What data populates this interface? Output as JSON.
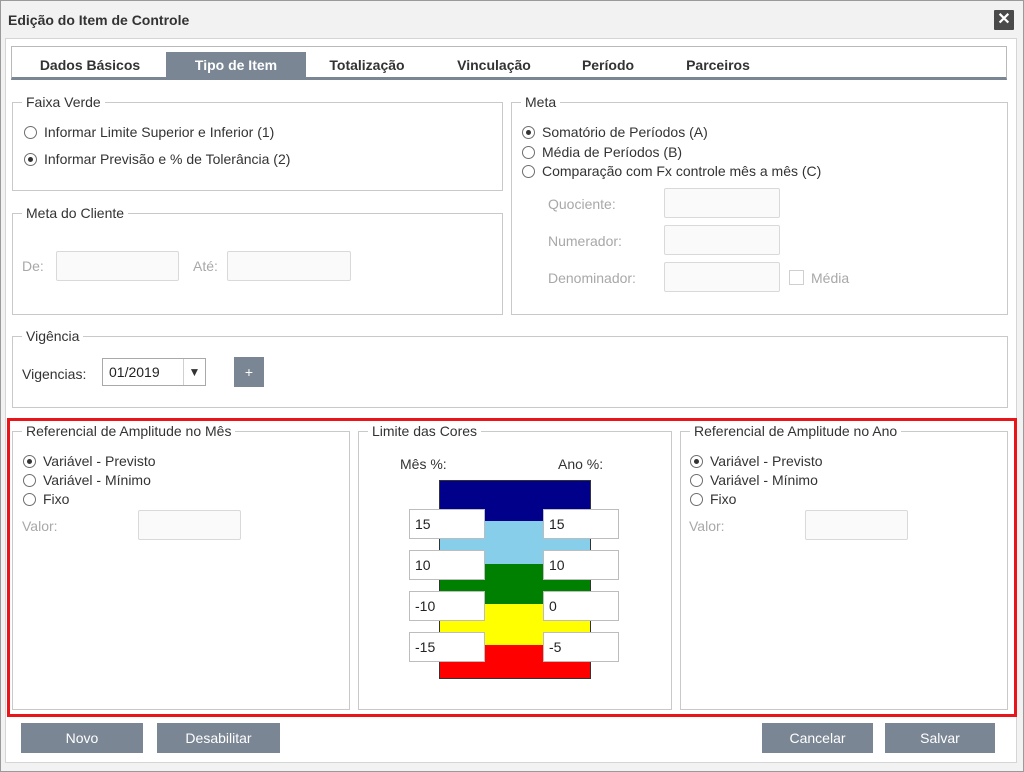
{
  "window": {
    "title": "Edição do Item de Controle",
    "close_glyph": "✕"
  },
  "tabs": [
    {
      "label": "Dados Básicos",
      "active": false
    },
    {
      "label": "Tipo de Item",
      "active": true
    },
    {
      "label": "Totalização",
      "active": false
    },
    {
      "label": "Vinculação",
      "active": false
    },
    {
      "label": "Período",
      "active": false
    },
    {
      "label": "Parceiros",
      "active": false
    }
  ],
  "faixa_verde": {
    "legend": "Faixa Verde",
    "options": [
      {
        "label": "Informar Limite Superior e Inferior (1)",
        "selected": false
      },
      {
        "label": "Informar Previsão e % de Tolerância (2)",
        "selected": true
      }
    ]
  },
  "meta_cliente": {
    "legend": "Meta do Cliente",
    "de_label": "De:",
    "de_value": "",
    "ate_label": "Até:",
    "ate_value": ""
  },
  "meta": {
    "legend": "Meta",
    "options": [
      {
        "label": "Somatório de Períodos (A)",
        "selected": true
      },
      {
        "label": "Média de Períodos (B)",
        "selected": false
      },
      {
        "label": "Comparação com Fx controle mês a mês (C)",
        "selected": false
      }
    ],
    "quociente_label": "Quociente:",
    "numerador_label": "Numerador:",
    "denominador_label": "Denominador:",
    "media_label": "Média",
    "media_checked": false
  },
  "vigencia": {
    "legend": "Vigência",
    "label": "Vigencias:",
    "selected": "01/2019",
    "add_label": "+"
  },
  "amplitude_mes": {
    "legend": "Referencial de Amplitude no Mês",
    "options": [
      {
        "label": "Variável - Previsto",
        "selected": true
      },
      {
        "label": "Variável - Mínimo",
        "selected": false
      },
      {
        "label": "Fixo",
        "selected": false
      }
    ],
    "valor_label": "Valor:",
    "valor_value": ""
  },
  "limite_cores": {
    "legend": "Limite das Cores",
    "mes_label": "Mês %:",
    "ano_label": "Ano %:",
    "bands": [
      "#00008b",
      "#87ceeb",
      "#008000",
      "#ffff00",
      "#ff0000"
    ],
    "mes_values": [
      "15",
      "10",
      "-10",
      "-15"
    ],
    "ano_values": [
      "15",
      "10",
      "0",
      "-5"
    ]
  },
  "amplitude_ano": {
    "legend": "Referencial de Amplitude no Ano",
    "options": [
      {
        "label": "Variável - Previsto",
        "selected": true
      },
      {
        "label": "Variável - Mínimo",
        "selected": false
      },
      {
        "label": "Fixo",
        "selected": false
      }
    ],
    "valor_label": "Valor:",
    "valor_value": ""
  },
  "buttons": {
    "novo": "Novo",
    "desabilitar": "Desabilitar",
    "cancelar": "Cancelar",
    "salvar": "Salvar"
  },
  "colors": {
    "accent": "#7a8694",
    "highlight": "#e8151b"
  }
}
